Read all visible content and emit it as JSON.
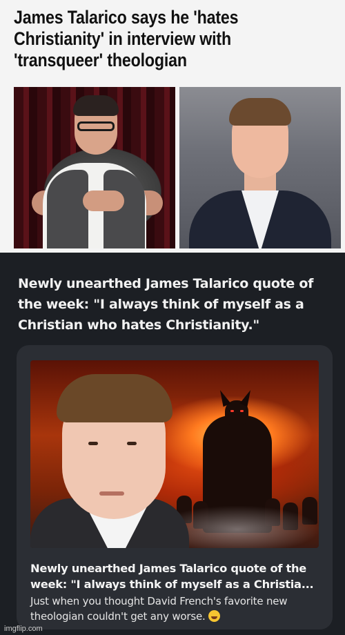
{
  "article": {
    "headline": "James Talarico says he 'hates Christianity' in interview with 'transqueer' theologian"
  },
  "post": {
    "text": "Newly unearthed James Talarico quote of the week: \"I always think of myself as a Christian who hates Christianity.\"",
    "card": {
      "title": "Newly unearthed James Talarico quote of the week: \"I always think of myself as a Christia...",
      "description": "Just when you thought David French's favorite new theologian couldn't get any worse."
    }
  },
  "watermark": "imgflip.com",
  "colors": {
    "article_bg": "#f4f4f4",
    "post_bg": "#1c1f24",
    "card_bg": "#2b2e34"
  },
  "icons": {
    "emoji": "laughing-crying-emoji"
  }
}
